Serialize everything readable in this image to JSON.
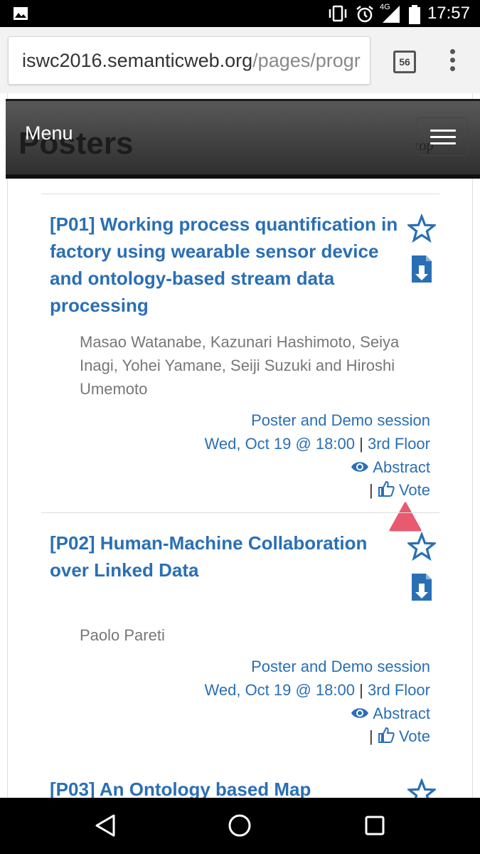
{
  "status": {
    "time": "17:57",
    "network": "4G"
  },
  "browser": {
    "url_host": "iswc2016.semanticweb.org",
    "url_path": "/pages/progr",
    "tab_count": "56"
  },
  "header": {
    "menu_label": "Menu",
    "ghost_title": "Posters",
    "ghost_top": "top"
  },
  "posters": [
    {
      "title": "[P01] Working process quantification in factory using wearable sensor device and ontology-based stream data processing",
      "authors": "Masao Watanabe, Kazunari Hashimoto, Seiya Inagi, Yohei Yamane, Seiji Suzuki and Hiroshi Umemoto",
      "session": "Poster and Demo session",
      "datetime": "Wed, Oct 19 @ 18:00",
      "separator": "|",
      "location": "3rd Floor",
      "abstract_label": "Abstract",
      "vote_label": "Vote"
    },
    {
      "title": "[P02] Human-Machine Collaboration over Linked Data",
      "authors": "Paolo Pareti",
      "session": "Poster and Demo session",
      "datetime": "Wed, Oct 19 @ 18:00",
      "separator": "|",
      "location": "3rd Floor",
      "abstract_label": "Abstract",
      "vote_label": "Vote"
    },
    {
      "title": "[P03] An Ontology based Map"
    }
  ],
  "colors": {
    "link": "#2a6fb4",
    "pointer": "#e85a6f"
  }
}
